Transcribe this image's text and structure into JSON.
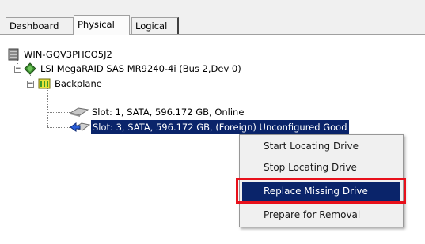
{
  "tabs": [
    "Dashboard",
    "Physical",
    "Logical"
  ],
  "active_tab": "Physical",
  "tree": {
    "server": "WIN-GQV3PHCO5J2",
    "controller": "LSI MegaRAID SAS MR9240-4i (Bus 2,Dev 0)",
    "backplane": "Backplane",
    "slot1": "Slot: 1, SATA, 596.172 GB, Online",
    "slot3": "Slot: 3, SATA, 596.172 GB, (Foreign) Unconfigured Good"
  },
  "context_menu": {
    "items": [
      "Start Locating Drive",
      "Stop Locating Drive",
      "Replace Missing Drive",
      "Prepare for Removal"
    ],
    "highlighted": "Replace Missing Drive"
  },
  "colors": {
    "selection": "#0a246a",
    "annotation_box": "#e8101b",
    "menu_background": "#f0f0f0"
  },
  "icons": {
    "server": "server-icon",
    "controller": "controller-chip-icon",
    "backplane": "backplane-icon",
    "slot1": "hard-drive-icon",
    "slot3": "foreign-drive-icon"
  }
}
